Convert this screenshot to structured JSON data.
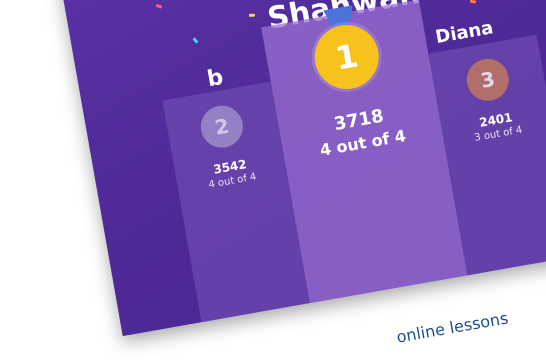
{
  "winner": {
    "name": "Shahwan",
    "rank": "1",
    "score": "3718",
    "progress": "4 out of 4",
    "medal_color": "#f7c21c"
  },
  "second": {
    "name": "b",
    "rank": "2",
    "score": "3542",
    "progress": "4 out of 4",
    "medal_color": "#a99bd0"
  },
  "third": {
    "name": "Diana",
    "rank": "3",
    "score": "2401",
    "progress": "3 out of 4",
    "medal_color": "#c67a5a"
  },
  "caption": "online lessons",
  "colors": {
    "background": "#5a33a6",
    "accent": "#4b73d8"
  }
}
